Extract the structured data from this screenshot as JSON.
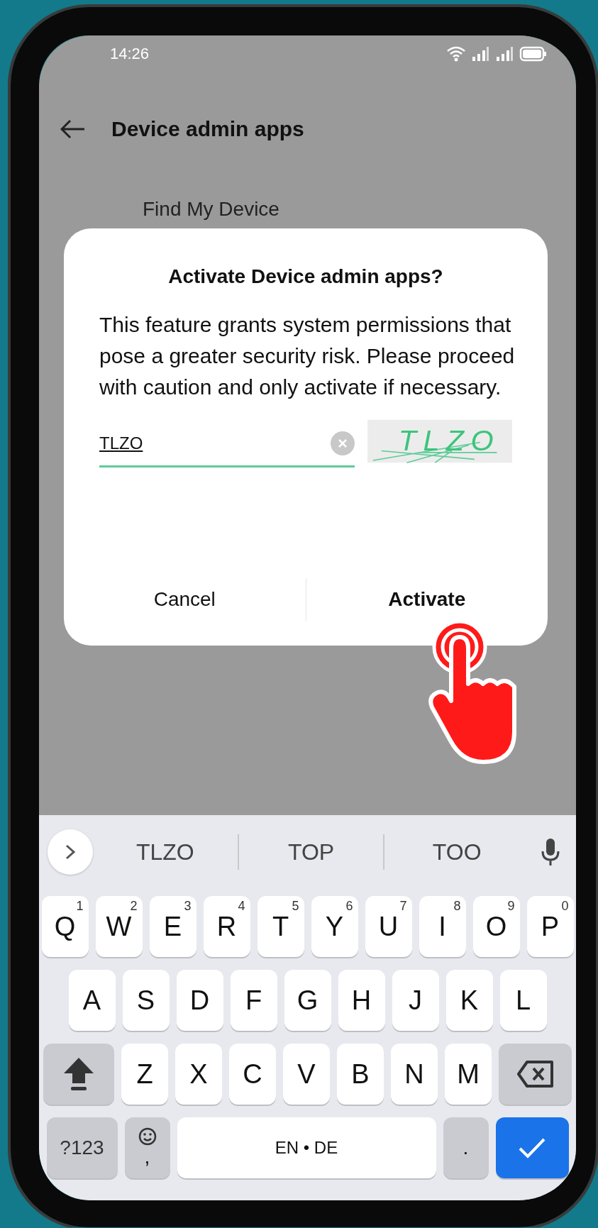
{
  "status_bar": {
    "time": "14:26"
  },
  "header": {
    "title": "Device admin apps"
  },
  "list": {
    "items": [
      "Find My Device"
    ]
  },
  "dialog": {
    "title": "Activate Device admin apps?",
    "message": "This feature grants system permissions that pose a greater security risk. Please proceed with caution and only activate if necessary.",
    "input": {
      "value": "TLZO"
    },
    "captcha": {
      "text": "TLZO"
    },
    "buttons": [
      {
        "label": "Cancel",
        "kind": "secondary"
      },
      {
        "label": "Activate",
        "kind": "primary"
      }
    ]
  },
  "keyboard": {
    "suggestions": [
      "TLZO",
      "TOP",
      "TOO"
    ],
    "rows": [
      {
        "keys": [
          {
            "kind": "letter",
            "label": "Q",
            "hint": "1"
          },
          {
            "kind": "letter",
            "label": "W",
            "hint": "2"
          },
          {
            "kind": "letter",
            "label": "E",
            "hint": "3"
          },
          {
            "kind": "letter",
            "label": "R",
            "hint": "4"
          },
          {
            "kind": "letter",
            "label": "T",
            "hint": "5"
          },
          {
            "kind": "letter",
            "label": "Y",
            "hint": "6"
          },
          {
            "kind": "letter",
            "label": "U",
            "hint": "7"
          },
          {
            "kind": "letter",
            "label": "I",
            "hint": "8"
          },
          {
            "kind": "letter",
            "label": "O",
            "hint": "9"
          },
          {
            "kind": "letter",
            "label": "P",
            "hint": "0"
          }
        ]
      },
      {
        "keys": [
          {
            "kind": "letter",
            "label": "A"
          },
          {
            "kind": "letter",
            "label": "S"
          },
          {
            "kind": "letter",
            "label": "D"
          },
          {
            "kind": "letter",
            "label": "F"
          },
          {
            "kind": "letter",
            "label": "G"
          },
          {
            "kind": "letter",
            "label": "H"
          },
          {
            "kind": "letter",
            "label": "J"
          },
          {
            "kind": "letter",
            "label": "K"
          },
          {
            "kind": "letter",
            "label": "L"
          }
        ]
      },
      {
        "keys": [
          {
            "kind": "shift"
          },
          {
            "kind": "letter",
            "label": "Z"
          },
          {
            "kind": "letter",
            "label": "X"
          },
          {
            "kind": "letter",
            "label": "C"
          },
          {
            "kind": "letter",
            "label": "V"
          },
          {
            "kind": "letter",
            "label": "B"
          },
          {
            "kind": "letter",
            "label": "N"
          },
          {
            "kind": "letter",
            "label": "M"
          },
          {
            "kind": "backspace"
          }
        ]
      },
      {
        "keys": [
          {
            "kind": "symbols",
            "label": "?123"
          },
          {
            "kind": "emoji",
            "label": ","
          },
          {
            "kind": "space",
            "label": "EN • DE"
          },
          {
            "kind": "period",
            "label": "."
          },
          {
            "kind": "enter"
          }
        ]
      }
    ]
  }
}
